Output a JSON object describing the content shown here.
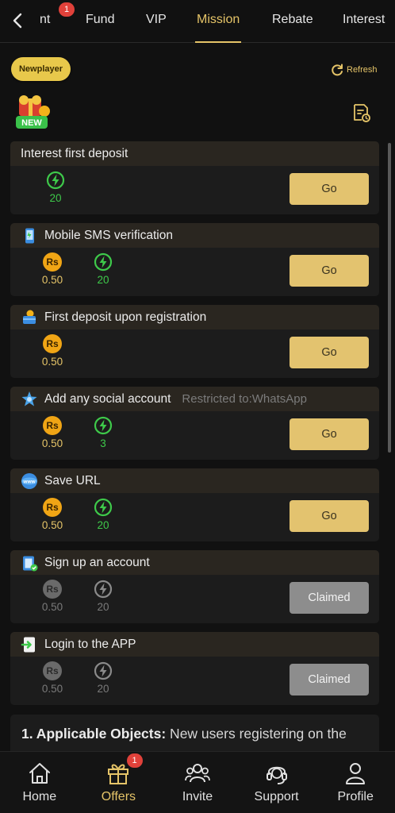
{
  "tabs": [
    {
      "label": "nt",
      "badge": "1"
    },
    {
      "label": "Fund"
    },
    {
      "label": "VIP"
    },
    {
      "label": "Mission",
      "active": true
    },
    {
      "label": "Rebate"
    },
    {
      "label": "Interest"
    }
  ],
  "newplayer_label": "Newplayer",
  "refresh_label": "Refresh",
  "new_badge_label": "NEW",
  "missions": [
    {
      "title": "Interest first deposit",
      "icon": "none",
      "coin": null,
      "energy": "20",
      "button": "Go",
      "claimed": false
    },
    {
      "title": "Mobile SMS verification",
      "icon": "phone-icon",
      "coin": "0.50",
      "energy": "20",
      "button": "Go",
      "claimed": false
    },
    {
      "title": "First deposit upon registration",
      "icon": "deposit-icon",
      "coin": "0.50",
      "energy": null,
      "button": "Go",
      "claimed": false
    },
    {
      "title": "Add any social account",
      "restriction": "Restricted to:WhatsApp",
      "icon": "social-icon",
      "coin": "0.50",
      "energy": "3",
      "button": "Go",
      "claimed": false
    },
    {
      "title": "Save URL",
      "icon": "www-icon",
      "coin": "0.50",
      "energy": "20",
      "button": "Go",
      "claimed": false
    },
    {
      "title": "Sign up an account",
      "icon": "clipboard-icon",
      "coin": "0.50",
      "energy": "20",
      "button": "Claimed",
      "claimed": true
    },
    {
      "title": "Login to the APP",
      "icon": "app-login-icon",
      "coin": "0.50",
      "energy": "20",
      "button": "Claimed",
      "claimed": true
    }
  ],
  "coin_symbol": "Rs",
  "rules": {
    "heading": "1. Applicable Objects:",
    "text": " New users registering on the"
  },
  "nav": [
    {
      "label": "Home",
      "icon": "home-icon"
    },
    {
      "label": "Offers",
      "icon": "gift-icon",
      "active": true,
      "badge": "1"
    },
    {
      "label": "Invite",
      "icon": "invite-icon"
    },
    {
      "label": "Support",
      "icon": "headset-icon"
    },
    {
      "label": "Profile",
      "icon": "profile-icon"
    }
  ],
  "colors": {
    "accent": "#e5c468",
    "energy": "#3ec94a",
    "coin": "#f0a515",
    "badge": "#e0413a",
    "claimed": "#8d8d8d"
  }
}
